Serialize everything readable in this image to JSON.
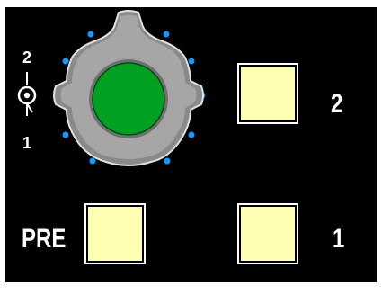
{
  "selector": {
    "label_top": "2",
    "label_bottom": "1",
    "icon": "input-selector-icon",
    "knob_color": "#00a020",
    "led_color": "#0a9cff"
  },
  "buttons": {
    "two": {
      "label": "2",
      "color": "#ffffb3"
    },
    "pre": {
      "label": "PRE",
      "color": "#ffffb3"
    },
    "one": {
      "label": "1",
      "color": "#ffffb3"
    }
  }
}
